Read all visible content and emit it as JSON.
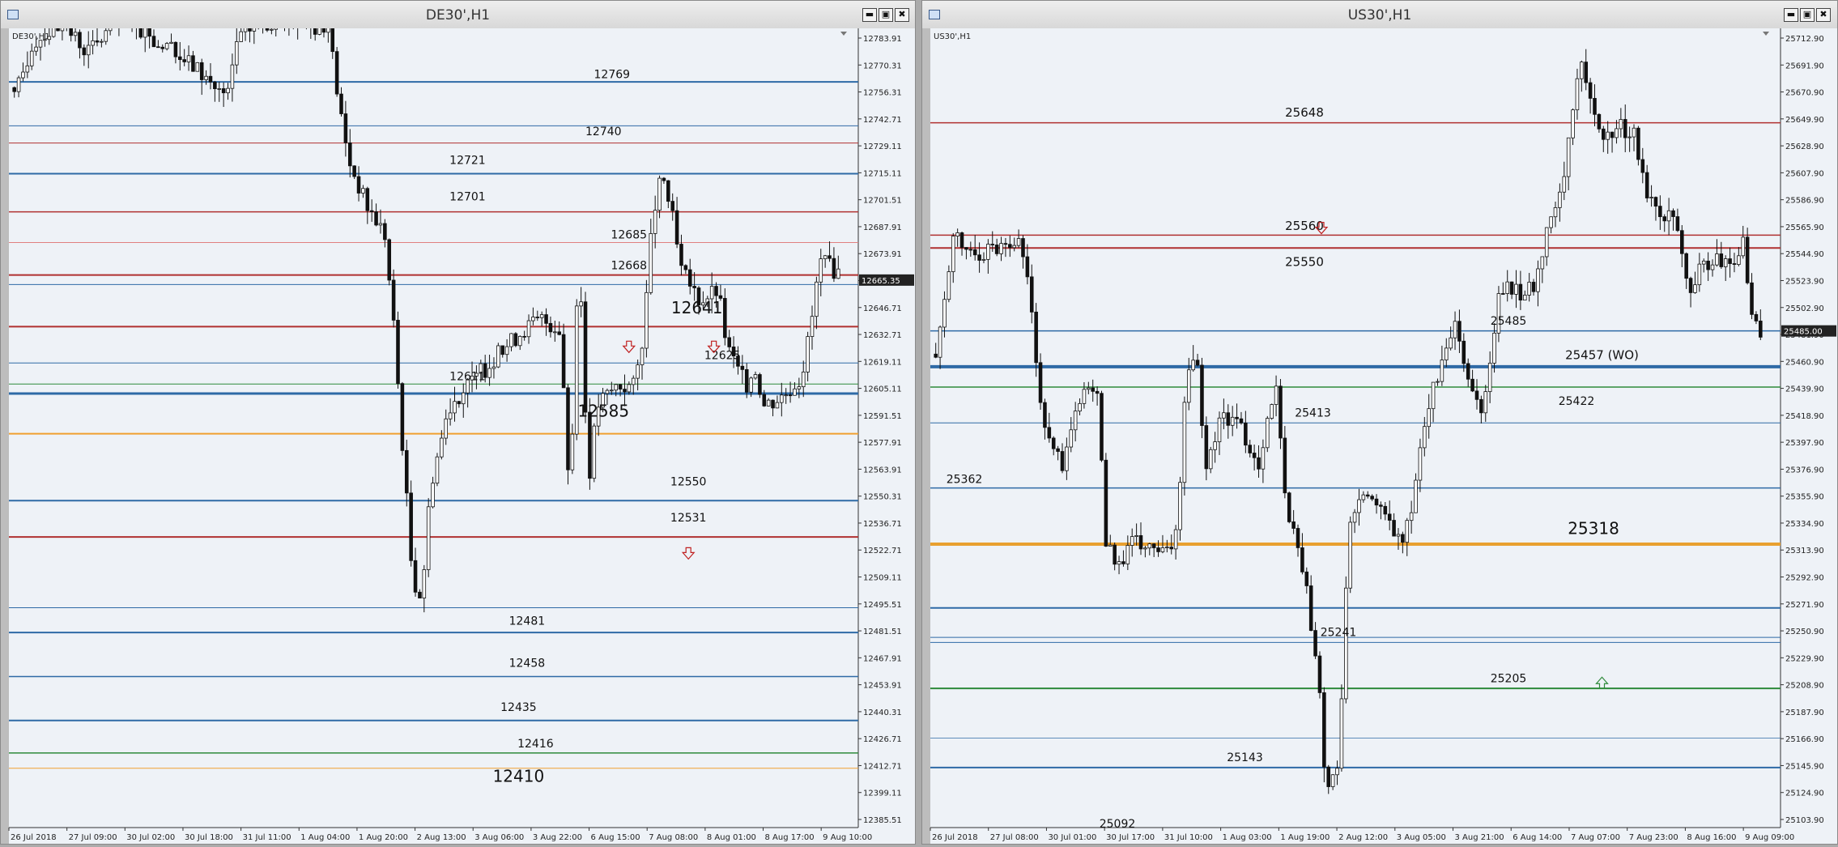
{
  "windows": [
    {
      "id": "de30",
      "title": "DE30',H1",
      "chart_label": "DE30',H1",
      "chart_data": {
        "type": "candlestick",
        "symbol": "DE30'",
        "timeframe": "H1",
        "ylim": [
          12379,
          12797
        ],
        "y_ticks": [
          "12783.91",
          "12770.31",
          "12756.31",
          "12742.71",
          "12729.11",
          "12715.11",
          "12701.51",
          "12687.91",
          "12673.91",
          "12660.31",
          "12646.71",
          "12632.71",
          "12619.11",
          "12605.11",
          "12591.51",
          "12577.91",
          "12563.91",
          "12550.31",
          "12536.71",
          "12522.71",
          "12509.11",
          "12495.51",
          "12481.51",
          "12467.91",
          "12453.91",
          "12440.31",
          "12426.71",
          "12412.71",
          "12399.11",
          "12385.51"
        ],
        "x_ticks": [
          "26 Jul 2018",
          "27 Jul 09:00",
          "30 Jul 02:00",
          "30 Jul 18:00",
          "31 Jul 11:00",
          "1 Aug 04:00",
          "1 Aug 20:00",
          "2 Aug 13:00",
          "3 Aug 06:00",
          "3 Aug 22:00",
          "6 Aug 15:00",
          "7 Aug 08:00",
          "8 Aug 01:00",
          "8 Aug 17:00",
          "9 Aug 10:00"
        ],
        "current_price": "12665.35",
        "levels": [
          {
            "price": 12769,
            "color": "#2e6aa6",
            "width": 2
          },
          {
            "price": 12746,
            "color": "#2e6aa6",
            "width": 1
          },
          {
            "price": 12737,
            "color": "#b03030",
            "width": 1
          },
          {
            "price": 12721,
            "color": "#2e6aa6",
            "width": 2
          },
          {
            "price": 12701,
            "color": "#b03030",
            "width": 1.5
          },
          {
            "price": 12685,
            "color": "#e08080",
            "width": 1
          },
          {
            "price": 12668,
            "color": "#b03030",
            "width": 2
          },
          {
            "price": 12663,
            "color": "#2e6aa6",
            "width": 1
          },
          {
            "price": 12641,
            "color": "#b03030",
            "width": 2
          },
          {
            "price": 12622,
            "color": "#2e6aa6",
            "width": 1
          },
          {
            "price": 12611,
            "color": "#2e8a3a",
            "width": 1
          },
          {
            "price": 12606,
            "color": "#2e6aa6",
            "width": 3
          },
          {
            "price": 12585,
            "color": "#f0a030",
            "width": 2
          },
          {
            "price": 12550,
            "color": "#2e6aa6",
            "width": 2
          },
          {
            "price": 12531,
            "color": "#b03030",
            "width": 2
          },
          {
            "price": 12494,
            "color": "#2e6aa6",
            "width": 1
          },
          {
            "price": 12481,
            "color": "#2e6aa6",
            "width": 2
          },
          {
            "price": 12458,
            "color": "#2e6aa6",
            "width": 1.5
          },
          {
            "price": 12435,
            "color": "#2e6aa6",
            "width": 2
          },
          {
            "price": 12418,
            "color": "#2e8a3a",
            "width": 1.5
          },
          {
            "price": 12410,
            "color": "#f0a030",
            "width": 1
          }
        ],
        "annotations": [
          {
            "text": "12769",
            "price": 12771,
            "pos": 0.71,
            "size": 14
          },
          {
            "text": "12740",
            "price": 12741,
            "pos": 0.7,
            "size": 14
          },
          {
            "text": "12721",
            "price": 12726,
            "pos": 0.54,
            "size": 14
          },
          {
            "text": "12701",
            "price": 12707,
            "pos": 0.54,
            "size": 14
          },
          {
            "text": "12685",
            "price": 12687,
            "pos": 0.73,
            "size": 14
          },
          {
            "text": "12668",
            "price": 12671,
            "pos": 0.73,
            "size": 14
          },
          {
            "text": "12641",
            "price": 12648,
            "pos": 0.81,
            "size": 20
          },
          {
            "text": "12625",
            "price": 12624,
            "pos": 0.84,
            "size": 14
          },
          {
            "text": "12611",
            "price": 12613,
            "pos": 0.54,
            "size": 14
          },
          {
            "text": "12585",
            "price": 12594,
            "pos": 0.7,
            "size": 20
          },
          {
            "text": "12550",
            "price": 12558,
            "pos": 0.8,
            "size": 14
          },
          {
            "text": "12531",
            "price": 12539,
            "pos": 0.8,
            "size": 14
          },
          {
            "text": "12481",
            "price": 12485,
            "pos": 0.61,
            "size": 14
          },
          {
            "text": "12458",
            "price": 12463,
            "pos": 0.61,
            "size": 14
          },
          {
            "text": "12435",
            "price": 12440,
            "pos": 0.6,
            "size": 14
          },
          {
            "text": "12416",
            "price": 12421,
            "pos": 0.62,
            "size": 14
          },
          {
            "text": "12410",
            "price": 12403,
            "pos": 0.6,
            "size": 20
          }
        ],
        "arrows": [
          {
            "dir": "down",
            "price": 12630,
            "pos": 0.73,
            "color": "#c02020"
          },
          {
            "dir": "down",
            "price": 12630,
            "pos": 0.83,
            "color": "#c02020"
          },
          {
            "dir": "down",
            "price": 12522,
            "pos": 0.8,
            "color": "#c02020"
          }
        ],
        "path": [
          [
            0,
            12760
          ],
          [
            0.02,
            12790
          ],
          [
            0.05,
            12800
          ],
          [
            0.08,
            12785
          ],
          [
            0.11,
            12800
          ],
          [
            0.14,
            12795
          ],
          [
            0.17,
            12785
          ],
          [
            0.2,
            12775
          ],
          [
            0.23,
            12760
          ],
          [
            0.24,
            12790
          ],
          [
            0.26,
            12800
          ],
          [
            0.28,
            12800
          ],
          [
            0.3,
            12800
          ],
          [
            0.32,
            12800
          ],
          [
            0.34,
            12795
          ],
          [
            0.35,
            12760
          ],
          [
            0.36,
            12730
          ],
          [
            0.38,
            12705
          ],
          [
            0.4,
            12690
          ],
          [
            0.41,
            12640
          ],
          [
            0.43,
            12510
          ],
          [
            0.44,
            12500
          ],
          [
            0.45,
            12560
          ],
          [
            0.47,
            12600
          ],
          [
            0.49,
            12610
          ],
          [
            0.51,
            12620
          ],
          [
            0.53,
            12630
          ],
          [
            0.55,
            12640
          ],
          [
            0.57,
            12645
          ],
          [
            0.59,
            12640
          ],
          [
            0.6,
            12550
          ],
          [
            0.61,
            12680
          ],
          [
            0.62,
            12560
          ],
          [
            0.63,
            12600
          ],
          [
            0.65,
            12610
          ],
          [
            0.67,
            12610
          ],
          [
            0.68,
            12640
          ],
          [
            0.69,
            12700
          ],
          [
            0.7,
            12720
          ],
          [
            0.71,
            12700
          ],
          [
            0.72,
            12670
          ],
          [
            0.74,
            12655
          ],
          [
            0.76,
            12660
          ],
          [
            0.77,
            12630
          ],
          [
            0.79,
            12610
          ],
          [
            0.8,
            12620
          ],
          [
            0.81,
            12600
          ],
          [
            0.83,
            12605
          ],
          [
            0.85,
            12615
          ],
          [
            0.86,
            12640
          ],
          [
            0.87,
            12675
          ],
          [
            0.89,
            12670
          ]
        ]
      }
    },
    {
      "id": "us30",
      "title": "US30',H1",
      "chart_label": "US30',H1",
      "chart_data": {
        "type": "candlestick",
        "symbol": "US30'",
        "timeframe": "H1",
        "ylim": [
          25096,
          25722
        ],
        "y_ticks": [
          "25712.90",
          "25691.90",
          "25670.90",
          "25649.90",
          "25628.90",
          "25607.90",
          "25586.90",
          "25565.90",
          "25544.90",
          "25523.90",
          "25502.90",
          "25481.90",
          "25460.90",
          "25439.90",
          "25418.90",
          "25397.90",
          "25376.90",
          "25355.90",
          "25334.90",
          "25313.90",
          "25292.90",
          "25271.90",
          "25250.90",
          "25229.90",
          "25208.90",
          "25187.90",
          "25166.90",
          "25145.90",
          "25124.90",
          "25103.90"
        ],
        "x_ticks": [
          "26 Jul 2018",
          "27 Jul 08:00",
          "30 Jul 01:00",
          "30 Jul 17:00",
          "31 Jul 10:00",
          "1 Aug 03:00",
          "1 Aug 19:00",
          "2 Aug 12:00",
          "3 Aug 05:00",
          "3 Aug 21:00",
          "6 Aug 14:00",
          "7 Aug 07:00",
          "7 Aug 23:00",
          "8 Aug 16:00",
          "9 Aug 09:00"
        ],
        "current_price": "25485.00",
        "levels": [
          {
            "price": 25648,
            "color": "#b03030",
            "width": 1.5
          },
          {
            "price": 25560,
            "color": "#b03030",
            "width": 1.5
          },
          {
            "price": 25550,
            "color": "#b03030",
            "width": 2
          },
          {
            "price": 25485,
            "color": "#2e6aa6",
            "width": 1.5
          },
          {
            "price": 25457,
            "color": "#2e6aa6",
            "width": 4
          },
          {
            "price": 25441,
            "color": "#2e8a3a",
            "width": 1.5
          },
          {
            "price": 25413,
            "color": "#2e6aa6",
            "width": 1
          },
          {
            "price": 25362,
            "color": "#2e6aa6",
            "width": 1.5
          },
          {
            "price": 25318,
            "color": "#e8a030",
            "width": 4
          },
          {
            "price": 25268,
            "color": "#2e6aa6",
            "width": 2
          },
          {
            "price": 25245,
            "color": "#2e6aa6",
            "width": 1
          },
          {
            "price": 25241,
            "color": "#2e6aa6",
            "width": 1
          },
          {
            "price": 25205,
            "color": "#2e8a3a",
            "width": 2
          },
          {
            "price": 25166,
            "color": "#2e6aa6",
            "width": 0.8
          },
          {
            "price": 25143,
            "color": "#2e6aa6",
            "width": 2
          }
        ],
        "annotations": [
          {
            "text": "25648",
            "price": 25653,
            "pos": 0.44,
            "size": 15
          },
          {
            "text": "25560",
            "price": 25564,
            "pos": 0.44,
            "size": 15
          },
          {
            "text": "25550",
            "price": 25536,
            "pos": 0.44,
            "size": 15
          },
          {
            "text": "25485",
            "price": 25490,
            "pos": 0.68,
            "size": 14
          },
          {
            "text": "25457 (WO)",
            "price": 25463,
            "pos": 0.79,
            "size": 15
          },
          {
            "text": "25422",
            "price": 25427,
            "pos": 0.76,
            "size": 14
          },
          {
            "text": "25413",
            "price": 25418,
            "pos": 0.45,
            "size": 14
          },
          {
            "text": "25362",
            "price": 25366,
            "pos": 0.04,
            "size": 14
          },
          {
            "text": "25318",
            "price": 25326,
            "pos": 0.78,
            "size": 20
          },
          {
            "text": "25241",
            "price": 25246,
            "pos": 0.48,
            "size": 14
          },
          {
            "text": "25205",
            "price": 25210,
            "pos": 0.68,
            "size": 14
          },
          {
            "text": "25143",
            "price": 25148,
            "pos": 0.37,
            "size": 14
          },
          {
            "text": "25092",
            "price": 25096,
            "pos": 0.22,
            "size": 14
          }
        ],
        "arrows": [
          {
            "dir": "down",
            "price": 25565,
            "pos": 0.46,
            "color": "#c02020"
          },
          {
            "dir": "up",
            "price": 25210,
            "pos": 0.79,
            "color": "#2e8a3a"
          }
        ],
        "path": [
          [
            0,
            25470
          ],
          [
            0.02,
            25560
          ],
          [
            0.04,
            25545
          ],
          [
            0.06,
            25550
          ],
          [
            0.08,
            25555
          ],
          [
            0.09,
            25560
          ],
          [
            0.1,
            25540
          ],
          [
            0.11,
            25480
          ],
          [
            0.12,
            25410
          ],
          [
            0.14,
            25380
          ],
          [
            0.16,
            25430
          ],
          [
            0.18,
            25440
          ],
          [
            0.19,
            25320
          ],
          [
            0.2,
            25300
          ],
          [
            0.22,
            25320
          ],
          [
            0.24,
            25315
          ],
          [
            0.26,
            25310
          ],
          [
            0.27,
            25340
          ],
          [
            0.28,
            25450
          ],
          [
            0.29,
            25470
          ],
          [
            0.3,
            25380
          ],
          [
            0.32,
            25420
          ],
          [
            0.34,
            25410
          ],
          [
            0.36,
            25380
          ],
          [
            0.37,
            25420
          ],
          [
            0.38,
            25440
          ],
          [
            0.39,
            25350
          ],
          [
            0.41,
            25300
          ],
          [
            0.42,
            25250
          ],
          [
            0.43,
            25200
          ],
          [
            0.43,
            25150
          ],
          [
            0.44,
            25125
          ],
          [
            0.45,
            25150
          ],
          [
            0.46,
            25330
          ],
          [
            0.48,
            25360
          ],
          [
            0.5,
            25340
          ],
          [
            0.51,
            25330
          ],
          [
            0.52,
            25320
          ],
          [
            0.53,
            25340
          ],
          [
            0.55,
            25430
          ],
          [
            0.57,
            25470
          ],
          [
            0.58,
            25490
          ],
          [
            0.59,
            25450
          ],
          [
            0.6,
            25440
          ],
          [
            0.61,
            25420
          ],
          [
            0.62,
            25470
          ],
          [
            0.63,
            25520
          ],
          [
            0.65,
            25515
          ],
          [
            0.67,
            25520
          ],
          [
            0.68,
            25560
          ],
          [
            0.7,
            25600
          ],
          [
            0.71,
            25660
          ],
          [
            0.72,
            25690
          ],
          [
            0.73,
            25660
          ],
          [
            0.74,
            25640
          ],
          [
            0.76,
            25645
          ],
          [
            0.78,
            25640
          ],
          [
            0.79,
            25600
          ],
          [
            0.81,
            25580
          ],
          [
            0.83,
            25560
          ],
          [
            0.84,
            25520
          ],
          [
            0.86,
            25540
          ],
          [
            0.88,
            25540
          ],
          [
            0.89,
            25530
          ],
          [
            0.9,
            25560
          ],
          [
            0.91,
            25500
          ],
          [
            0.92,
            25480
          ]
        ]
      }
    }
  ]
}
